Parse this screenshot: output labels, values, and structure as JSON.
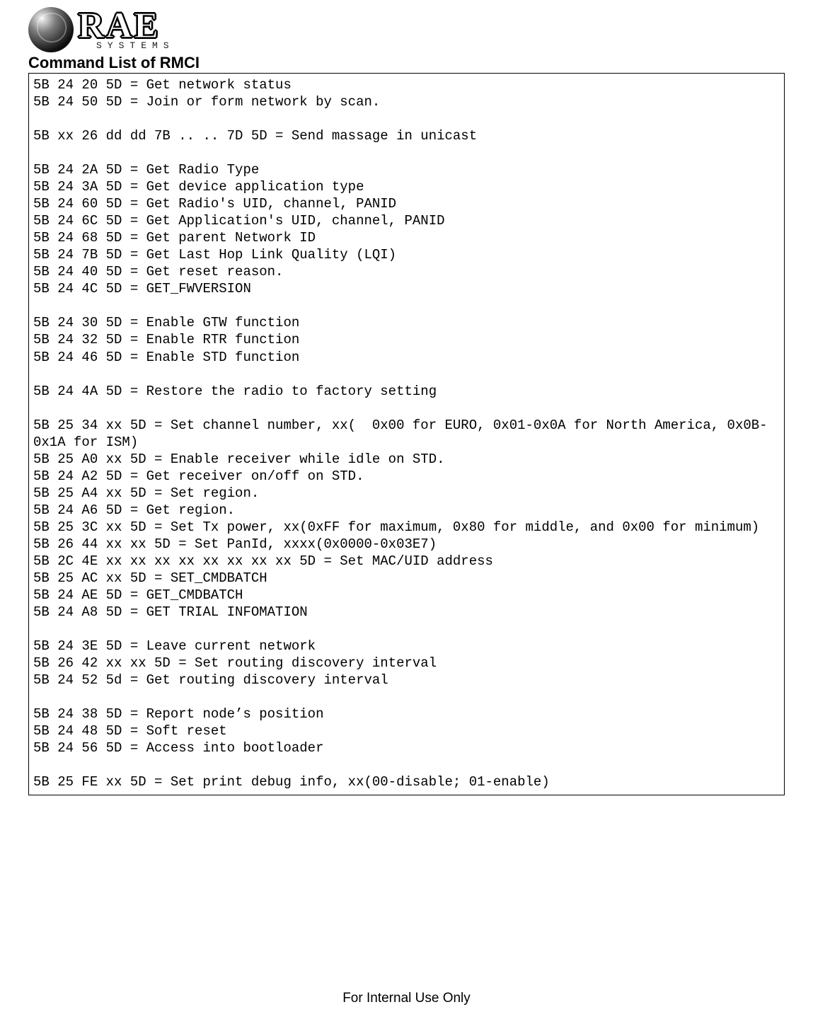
{
  "logo": {
    "rae": "RAE",
    "systems": "SYSTEMS"
  },
  "title": "Command List of RMCI",
  "sections": [
    {
      "lines": [
        "5B 24 20 5D = Get network status",
        "5B 24 50 5D = Join or form network by scan."
      ]
    },
    {
      "lines": [
        "5B xx 26 dd dd 7B .. .. 7D 5D = Send massage in unicast"
      ]
    },
    {
      "lines": [
        "5B 24 2A 5D = Get Radio Type",
        "5B 24 3A 5D = Get device application type",
        "5B 24 60 5D = Get Radio's UID, channel, PANID",
        "5B 24 6C 5D = Get Application's UID, channel, PANID",
        "5B 24 68 5D = Get parent Network ID",
        "5B 24 7B 5D = Get Last Hop Link Quality (LQI)",
        "5B 24 40 5D = Get reset reason.",
        "5B 24 4C 5D = GET_FWVERSION"
      ]
    },
    {
      "lines": [
        "5B 24 30 5D = Enable GTW function",
        "5B 24 32 5D = Enable RTR function",
        "5B 24 46 5D = Enable STD function"
      ]
    },
    {
      "lines": [
        "5B 24 4A 5D = Restore the radio to factory setting"
      ]
    },
    {
      "lines": [
        "5B 25 34 xx 5D = Set channel number, xx(  0x00 for EURO, 0x01-0x0A for North America, 0x0B-0x1A for ISM)",
        "5B 25 A0 xx 5D = Enable receiver while idle on STD.",
        "5B 24 A2 5D = Get receiver on/off on STD.",
        "5B 25 A4 xx 5D = Set region.",
        "5B 24 A6 5D = Get region.",
        "5B 25 3C xx 5D = Set Tx power, xx(0xFF for maximum, 0x80 for middle, and 0x00 for minimum)",
        "5B 26 44 xx xx 5D = Set PanId, xxxx(0x0000-0x03E7)",
        "5B 2C 4E xx xx xx xx xx xx xx xx 5D = Set MAC/UID address",
        "5B 25 AC xx 5D = SET_CMDBATCH",
        "5B 24 AE 5D = GET_CMDBATCH",
        "5B 24 A8 5D = GET TRIAL INFOMATION"
      ]
    },
    {
      "lines": [
        "5B 24 3E 5D = Leave current network",
        "5B 26 42 xx xx 5D = Set routing discovery interval",
        "5B 24 52 5d = Get routing discovery interval"
      ]
    },
    {
      "lines": [
        "5B 24 38 5D = Report node’s position",
        "5B 24 48 5D = Soft reset",
        "5B 24 56 5D = Access into bootloader"
      ]
    },
    {
      "lines": [
        "5B 25 FE xx 5D = Set print debug info, xx(00-disable; 01-enable)"
      ]
    }
  ],
  "footer": "For Internal Use Only"
}
